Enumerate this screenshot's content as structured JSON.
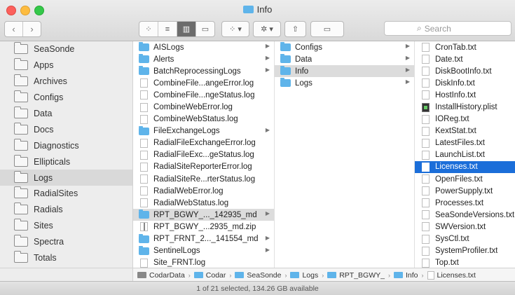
{
  "window": {
    "title": "Info"
  },
  "toolbar": {
    "back": "‹",
    "forward": "›",
    "view_icons": "⁘",
    "view_list": "≡",
    "view_columns": "▥",
    "view_coverflow": "▭",
    "arrange": "⁘ ▾",
    "action": "✲ ▾",
    "share": "⇧",
    "tags": "▭"
  },
  "search": {
    "placeholder": "Search",
    "value": ""
  },
  "sidebar": {
    "items": [
      {
        "label": "SeaSonde"
      },
      {
        "label": "Apps"
      },
      {
        "label": "Archives"
      },
      {
        "label": "Configs"
      },
      {
        "label": "Data"
      },
      {
        "label": "Docs"
      },
      {
        "label": "Diagnostics"
      },
      {
        "label": "Ellipticals"
      },
      {
        "label": "Logs",
        "selected": true
      },
      {
        "label": "RadialSites"
      },
      {
        "label": "Radials"
      },
      {
        "label": "Sites"
      },
      {
        "label": "Spectra"
      },
      {
        "label": "Totals"
      }
    ]
  },
  "columns": {
    "col1": [
      {
        "name": "AISLogs",
        "kind": "folder",
        "arrow": true
      },
      {
        "name": "Alerts",
        "kind": "folder",
        "arrow": true
      },
      {
        "name": "BatchReprocessingLogs",
        "kind": "folder",
        "arrow": true
      },
      {
        "name": "CombineFile...angeError.log",
        "kind": "doc"
      },
      {
        "name": "CombineFile...ngeStatus.log",
        "kind": "doc"
      },
      {
        "name": "CombineWebError.log",
        "kind": "doc"
      },
      {
        "name": "CombineWebStatus.log",
        "kind": "doc"
      },
      {
        "name": "FileExchangeLogs",
        "kind": "folder",
        "arrow": true
      },
      {
        "name": "RadialFileExchangeError.log",
        "kind": "doc"
      },
      {
        "name": "RadialFileExc...geStatus.log",
        "kind": "doc"
      },
      {
        "name": "RadialSiteReporterError.log",
        "kind": "doc"
      },
      {
        "name": "RadialSiteRe...rterStatus.log",
        "kind": "doc"
      },
      {
        "name": "RadialWebError.log",
        "kind": "doc"
      },
      {
        "name": "RadialWebStatus.log",
        "kind": "doc"
      },
      {
        "name": "RPT_BGWY_..._142935_md",
        "kind": "folder",
        "arrow": true,
        "selected": "gray"
      },
      {
        "name": "RPT_BGWY_...2935_md.zip",
        "kind": "zip"
      },
      {
        "name": "RPT_FRNT_2..._141554_md",
        "kind": "folder",
        "arrow": true
      },
      {
        "name": "SentinelLogs",
        "kind": "folder",
        "arrow": true
      },
      {
        "name": "Site_FRNT.log",
        "kind": "doc"
      }
    ],
    "col2": [
      {
        "name": "Configs",
        "kind": "folder",
        "arrow": true
      },
      {
        "name": "Data",
        "kind": "folder",
        "arrow": true
      },
      {
        "name": "Info",
        "kind": "folder",
        "arrow": true,
        "selected": "gray"
      },
      {
        "name": "Logs",
        "kind": "folder",
        "arrow": true
      }
    ],
    "col3": [
      {
        "name": "CronTab.txt",
        "kind": "doc"
      },
      {
        "name": "Date.txt",
        "kind": "doc"
      },
      {
        "name": "DiskBootInfo.txt",
        "kind": "doc"
      },
      {
        "name": "DiskInfo.txt",
        "kind": "doc"
      },
      {
        "name": "HostInfo.txt",
        "kind": "doc"
      },
      {
        "name": "InstallHistory.plist",
        "kind": "plist"
      },
      {
        "name": "IOReg.txt",
        "kind": "doc"
      },
      {
        "name": "KextStat.txt",
        "kind": "doc"
      },
      {
        "name": "LatestFiles.txt",
        "kind": "doc"
      },
      {
        "name": "LaunchList.txt",
        "kind": "doc"
      },
      {
        "name": "Licenses.txt",
        "kind": "doc",
        "selected": "blue"
      },
      {
        "name": "OpenFiles.txt",
        "kind": "doc"
      },
      {
        "name": "PowerSupply.txt",
        "kind": "doc"
      },
      {
        "name": "Processes.txt",
        "kind": "doc"
      },
      {
        "name": "SeaSondeVersions.txt",
        "kind": "doc"
      },
      {
        "name": "SWVersion.txt",
        "kind": "doc"
      },
      {
        "name": "SysCtl.txt",
        "kind": "doc"
      },
      {
        "name": "SystemProfiler.txt",
        "kind": "doc"
      },
      {
        "name": "Top.txt",
        "kind": "doc"
      }
    ]
  },
  "pathbar": {
    "segments": [
      {
        "label": "CodarData",
        "kind": "drive"
      },
      {
        "label": "Codar",
        "kind": "folder"
      },
      {
        "label": "SeaSonde",
        "kind": "folder"
      },
      {
        "label": "Logs",
        "kind": "folder"
      },
      {
        "label": "RPT_BGWY_",
        "kind": "folder"
      },
      {
        "label": "Info",
        "kind": "folder"
      },
      {
        "label": "Licenses.txt",
        "kind": "doc"
      }
    ]
  },
  "status": {
    "text": "1 of 21 selected, 134.26 GB available"
  },
  "colors": {
    "selection_blue": "#1b6ed9",
    "folder_blue": "#5fb4ea",
    "selection_gray": "#dcdcdc"
  }
}
